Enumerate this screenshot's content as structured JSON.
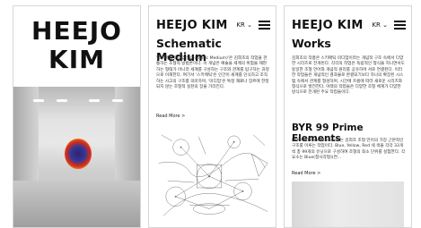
{
  "panel1": {
    "title_line1": "HEEJO",
    "title_line2": "KIM"
  },
  "panel2": {
    "brand": "HEEJO KIM",
    "lang": "KR",
    "title": "Schematic Medium",
    "body": "'스키매틱 미디엄(Schematic Medium)'은 김희조의 작업을 관통하는 조형적 방법론이다. 이 개념은 예술을 세계의 위험을 재현하는 형태가 아니라 세계를 구성하는 구조와 관계를 탐구하는 과정으로 이해한다. 여기서 '스키매틱'은 인간이 세계를 인식하고 조직하는 사고의 구조를 의미하며, '미디엄'은 특정 재료나 장르에 한정되지 않는 조형적 실천의 장을 가리킨다.",
    "read_more": "Read More >"
  },
  "panel3": {
    "brand": "HEEJO KIM",
    "lang": "KR",
    "title": "Works",
    "body": "김희조의 작품은 스키매틱 미디엄이라는 개념적 구조 속에서 다양한 시리즈로 전개된다. 각각의 작업은 독립적인 형식을 지니면서도 동일한 조형 언어와 개념적 원리를 공유하며 서로 연결된다. 이러한 작업들은 개념적인 결과물로 완결되기보다 하나의 확장된 시스템 속에서 관계를 형성하며, 시간에 흐름에 따라 새로운 시리즈와 형식으로 발전한다. 아래의 작업들은 다양한 조형 체계가 다양한 방식으로 전개된 주요 작업들이다.",
    "sub_title": "BYR 99 Prime Elements",
    "sub_body": "BYR 99 Prime Elements는 김희조 조형 언어의 가장 근본적인 구조를 이루는 작업이다. Blue, Yellow, Red 세 색을 각각 33개씩 총 99개의 유닛으로 구성하여 조형의 최소 단위를 실험한다. 각 요소는 Blue(청사각형)(연...",
    "read_more": "Read More >"
  }
}
